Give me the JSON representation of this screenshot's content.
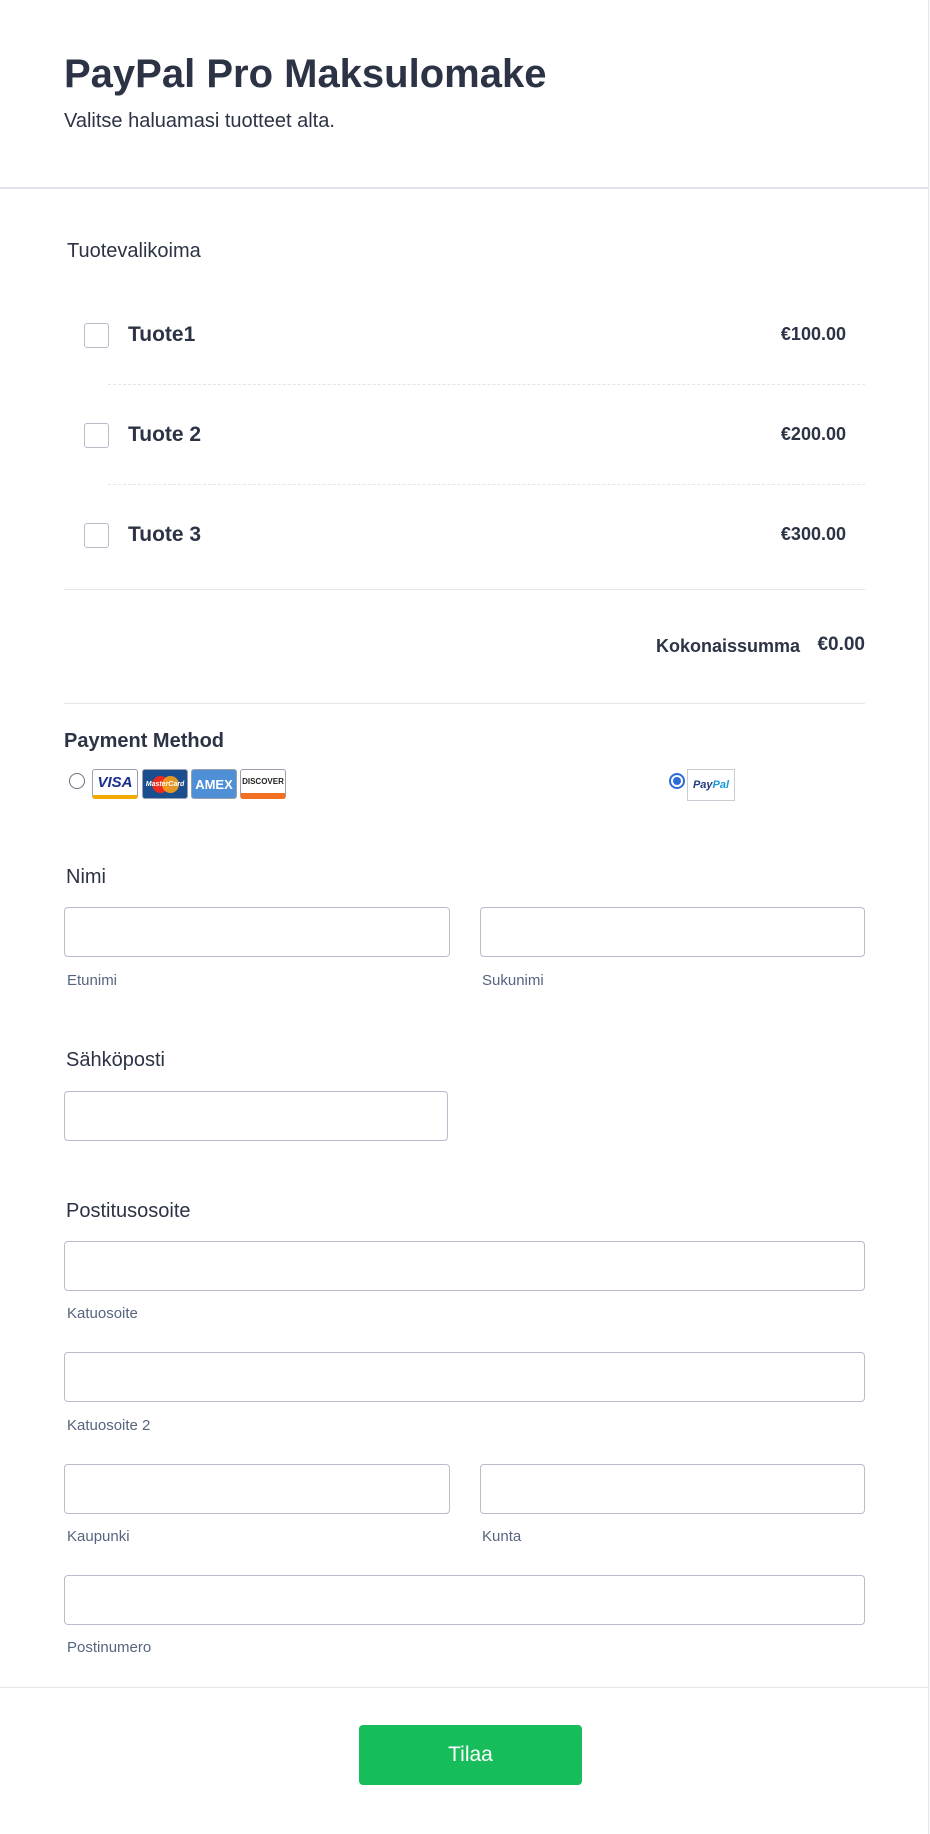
{
  "header": {
    "title": "PayPal Pro Maksulomake",
    "subtitle": "Valitse haluamasi tuotteet alta."
  },
  "products": {
    "label": "Tuotevalikoima",
    "items": [
      {
        "name": "Tuote1",
        "price": "€100.00",
        "checked": false
      },
      {
        "name": "Tuote 2",
        "price": "€200.00",
        "checked": false
      },
      {
        "name": "Tuote 3",
        "price": "€300.00",
        "checked": false
      }
    ],
    "total_label": "Kokonaissumma",
    "total_value": "€0.00"
  },
  "payment": {
    "title": "Payment Method",
    "options": [
      {
        "id": "credit-card",
        "selected": false,
        "logos": [
          "VISA",
          "MasterCard",
          "AMEX",
          "DISCOVER"
        ]
      },
      {
        "id": "paypal",
        "selected": true,
        "logo_text_a": "Pay",
        "logo_text_b": "Pal"
      }
    ]
  },
  "name": {
    "label": "Nimi",
    "first_sublabel": "Etunimi",
    "last_sublabel": "Sukunimi",
    "first_value": "",
    "last_value": ""
  },
  "email": {
    "label": "Sähköposti",
    "value": ""
  },
  "address": {
    "label": "Postitusosoite",
    "street_sublabel": "Katuosoite",
    "street2_sublabel": "Katuosoite 2",
    "city_sublabel": "Kaupunki",
    "region_sublabel": "Kunta",
    "postal_sublabel": "Postinumero"
  },
  "submit": {
    "label": "Tilaa"
  },
  "colors": {
    "submit_bg": "#18bd5b",
    "text": "#2c3345",
    "radio_selected": "#2b6cd8"
  }
}
